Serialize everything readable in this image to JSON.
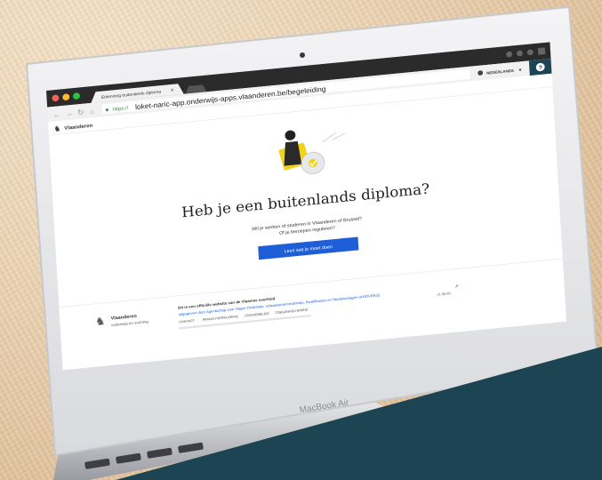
{
  "browser": {
    "tab_title": "Erkenning buitenlands diploma",
    "url_secure": "https://",
    "url_main": "loket-naric-app.onderwijs-apps.vlaanderen.be/begeleiding",
    "language": "NEDERLANDS"
  },
  "site": {
    "brand": "Vlaanderen"
  },
  "hero": {
    "heading": "Heb je een buitenlands diploma?",
    "subtext_line1": "Wil je werken of studeren in Vlaanderen of Brussel?",
    "subtext_line2": "Of je beroepen reguleren?",
    "cta_label": "Lees wat je moet doen"
  },
  "footer": {
    "brand": "Vlaanderen",
    "brand_sub": "onderwijs en vorming",
    "official_line": "Dit is een officiële website van de Vlaamse overheid",
    "publisher_line": "uitgegeven door Agentschap voor Hoger Onderwijs, Volwassenenonderwijs, Kwalificaties en Studietoelagen (AHOVOKS)",
    "links": [
      "CONTACT",
      "PRIVACYVERKLARING",
      "COOKIEBELEID",
      "TOEGANKELIJKHEID"
    ],
    "version": "v1.00.00"
  },
  "device": {
    "label": "MacBook Air"
  },
  "colors": {
    "cta": "#1e5ed6",
    "panel": "#1c4452",
    "accent_yellow": "#f3d21a"
  },
  "icons": [
    "close-icon",
    "back-icon",
    "forward-icon",
    "reload-icon",
    "home-icon",
    "lock-icon",
    "chevron-down-icon",
    "help-icon",
    "vlaanderen-lion-icon",
    "external-link-icon"
  ]
}
